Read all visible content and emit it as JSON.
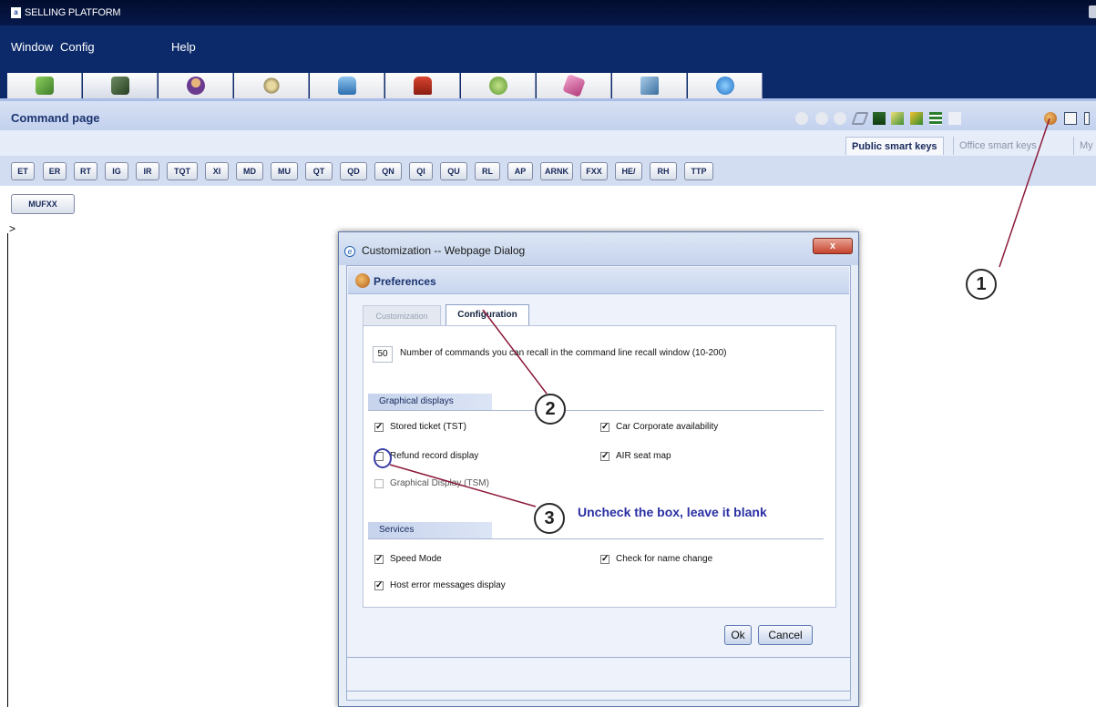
{
  "window": {
    "title": "SELLING PLATFORM",
    "app_icon": "a"
  },
  "menu": [
    "Window",
    "Config",
    "Help"
  ],
  "module_tabs": [
    {
      "icon": "book-icon",
      "color": "#5a9e3a"
    },
    {
      "icon": "tablet-icon",
      "color": "#3d5e33"
    },
    {
      "icon": "agent-icon",
      "color": "#b3532a"
    },
    {
      "icon": "sun-icon",
      "color": "#c9b46a"
    },
    {
      "icon": "car-icon",
      "color": "#3f8fd0"
    },
    {
      "icon": "bellboy-icon",
      "color": "#c9382a"
    },
    {
      "icon": "leaf-icon",
      "color": "#7ab04c"
    },
    {
      "icon": "ticket-icon",
      "color": "#c64d8b"
    },
    {
      "icon": "document-icon",
      "color": "#5b8fbf"
    },
    {
      "icon": "info-icon",
      "color": "#2e7fd1"
    }
  ],
  "command_page": {
    "title": "Command page",
    "smart_key_tabs": [
      "Public smart keys",
      "Office smart keys",
      "My"
    ],
    "keys": [
      "ET",
      "ER",
      "RT",
      "IG",
      "IR",
      "TQT",
      "XI",
      "MD",
      "MU",
      "QT",
      "QD",
      "QN",
      "QI",
      "QU",
      "RL",
      "AP",
      "ARNK",
      "FXX",
      "HE/",
      "RH",
      "TTP"
    ],
    "custom_key": "MUFXX",
    "prompt": ">"
  },
  "dialog": {
    "title": "Customization -- Webpage Dialog",
    "close_label": "x",
    "header": "Preferences",
    "tabs": {
      "customization": "Customization",
      "configuration": "Configuration"
    },
    "recall_count": "50",
    "recall_label": "Number of commands you can recall in the command line recall window (10-200)",
    "sections": {
      "graphical": "Graphical displays",
      "services": "Services"
    },
    "options": {
      "stored_ticket": {
        "label": "Stored ticket (TST)",
        "checked": true
      },
      "car_corporate": {
        "label": "Car Corporate availability",
        "checked": true
      },
      "refund_record": {
        "label": "Refund record display",
        "checked": false
      },
      "air_seat_map": {
        "label": "AIR seat map",
        "checked": true
      },
      "graphical_tsm": {
        "label": "Graphical Display (TSM)",
        "checked": false
      },
      "speed_mode": {
        "label": "Speed Mode",
        "checked": true
      },
      "name_change": {
        "label": "Check for name change",
        "checked": true
      },
      "host_error": {
        "label": "Host error messages display",
        "checked": true
      }
    },
    "ok": "Ok",
    "cancel": "Cancel"
  },
  "annotations": {
    "marker_1": "1",
    "marker_2": "2",
    "marker_3": "3",
    "note": "Uncheck the box, leave it blank"
  }
}
